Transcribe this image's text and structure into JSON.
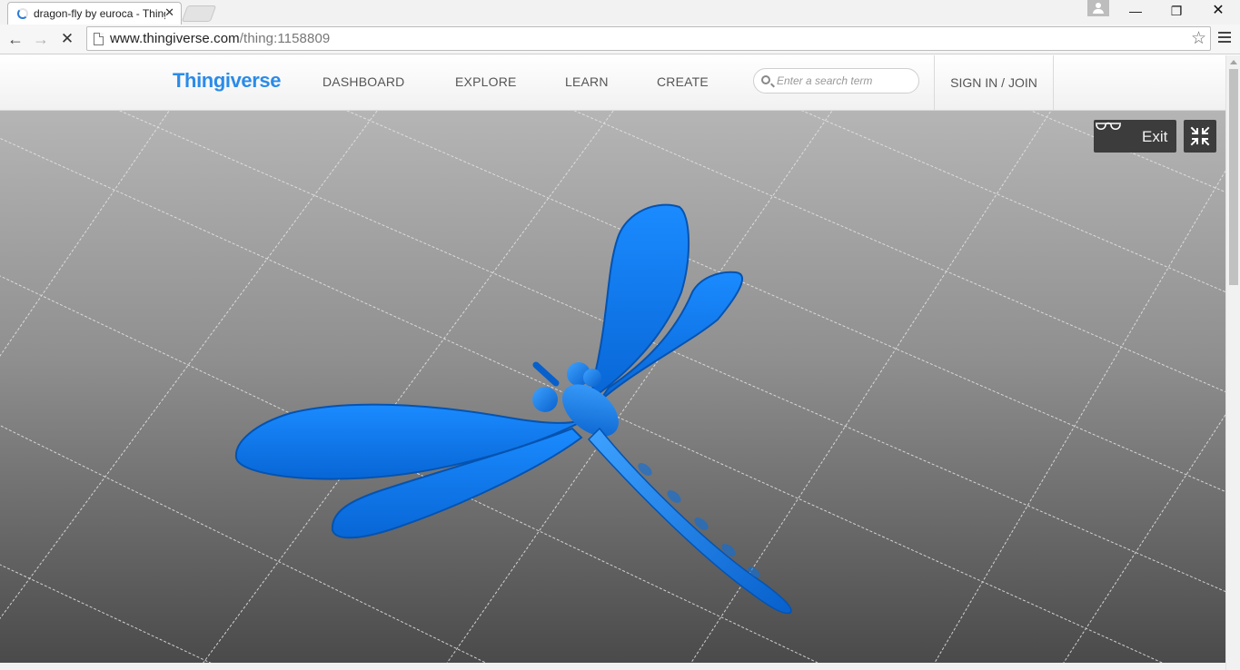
{
  "browser": {
    "tab_title": "dragon-fly by euroca - Thingiverse",
    "tab_close": "✕",
    "url_host": "www.thingiverse.com",
    "url_path": "/thing:1158809",
    "nav_back": "←",
    "nav_forward": "→",
    "nav_stop": "✕",
    "bookmark": "☆",
    "window_minimize": "—",
    "window_maximize": "❐",
    "window_close": "✕"
  },
  "site": {
    "logo": "Thingiverse",
    "nav": [
      "DASHBOARD",
      "EXPLORE",
      "LEARN",
      "CREATE"
    ],
    "search_placeholder": "Enter a search term",
    "signin": "SIGN IN / JOIN"
  },
  "viewer": {
    "exit_label": "Exit",
    "model_color": "#0a7cf5",
    "icons": [
      "glasses-icon",
      "collapse-icon"
    ]
  }
}
